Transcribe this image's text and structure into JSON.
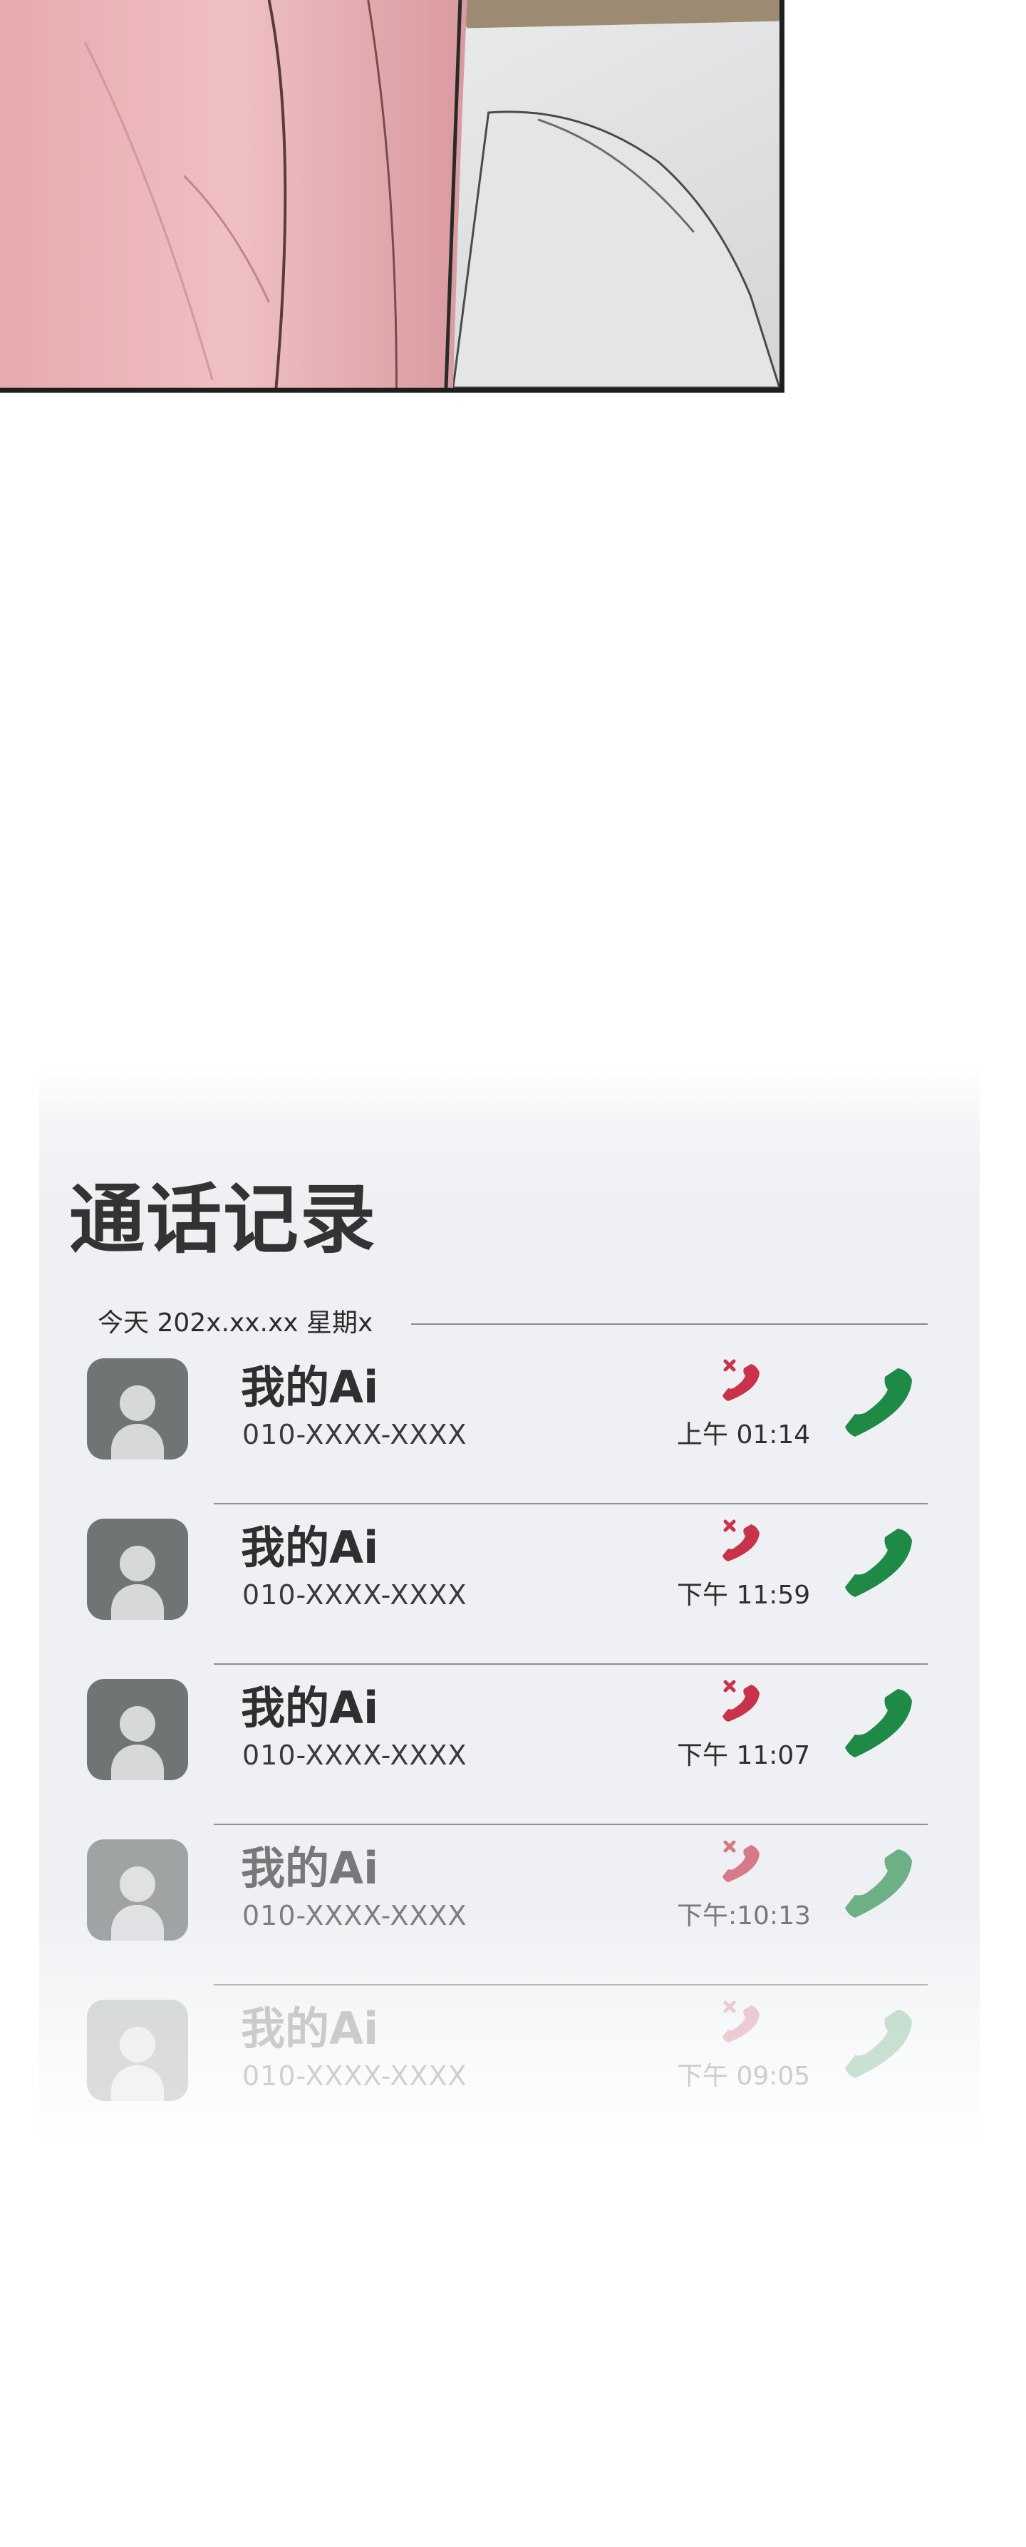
{
  "call_log": {
    "title": "通话记录",
    "date_header": "今天 202x.xx.xx 星期x",
    "entries": [
      {
        "name": "我的Ai",
        "number": "010-XXXX-XXXX",
        "time": "上午 01:14"
      },
      {
        "name": "我的Ai",
        "number": "010-XXXX-XXXX",
        "time": "下午 11:59"
      },
      {
        "name": "我的Ai",
        "number": "010-XXXX-XXXX",
        "time": "下午 11:07"
      },
      {
        "name": "我的Ai",
        "number": "010-XXXX-XXXX",
        "time": "下午:10:13"
      },
      {
        "name": "我的Ai",
        "number": "010-XXXX-XXXX",
        "time": "下午 09:05"
      }
    ],
    "icons": {
      "avatar": "person-avatar-icon",
      "missed": "missed-call-icon",
      "call": "phone-call-icon"
    },
    "colors": {
      "missed": "#c8334a",
      "call": "#1f8a45",
      "title": "#333333"
    }
  }
}
